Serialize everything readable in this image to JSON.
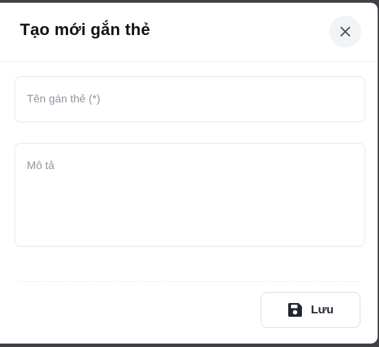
{
  "modal": {
    "title": "Tạo mới gắn thẻ",
    "close_icon": "close-icon"
  },
  "form": {
    "name_field": {
      "placeholder": "Tên gán thẻ (*)",
      "value": ""
    },
    "description_field": {
      "placeholder": "Mô tả",
      "value": ""
    }
  },
  "footer": {
    "save_label": "Lưu",
    "save_icon": "floppy-disk-icon"
  },
  "colors": {
    "backdrop": "#3f4144",
    "title_text": "#111418",
    "placeholder_text": "#8f95a0",
    "border": "#e4e6ea",
    "close_button_bg": "#f2f3f5",
    "save_icon": "#1f2733"
  }
}
